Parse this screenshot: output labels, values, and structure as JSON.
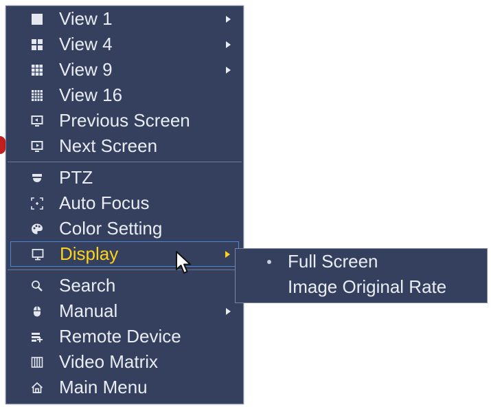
{
  "context_menu": {
    "items": [
      {
        "label": "View 1",
        "icon": "single-view-icon",
        "has_submenu": true
      },
      {
        "label": "View 4",
        "icon": "quad-view-icon",
        "has_submenu": true
      },
      {
        "label": "View 9",
        "icon": "nine-grid-icon",
        "has_submenu": true
      },
      {
        "label": "View 16",
        "icon": "sixteen-grid-icon",
        "has_submenu": false
      },
      {
        "label": "Previous Screen",
        "icon": "previous-screen-icon",
        "has_submenu": false
      },
      {
        "label": "Next Screen",
        "icon": "next-screen-icon",
        "has_submenu": false
      },
      {
        "label": "PTZ",
        "icon": "ptz-camera-icon",
        "has_submenu": false
      },
      {
        "label": "Auto Focus",
        "icon": "focus-icon",
        "has_submenu": false
      },
      {
        "label": "Color Setting",
        "icon": "palette-icon",
        "has_submenu": false
      },
      {
        "label": "Display",
        "icon": "monitor-icon",
        "has_submenu": true,
        "highlighted": true
      },
      {
        "label": "Search",
        "icon": "search-icon",
        "has_submenu": false
      },
      {
        "label": "Manual",
        "icon": "mouse-icon",
        "has_submenu": true
      },
      {
        "label": "Remote Device",
        "icon": "remote-device-icon",
        "has_submenu": false
      },
      {
        "label": "Video Matrix",
        "icon": "video-matrix-icon",
        "has_submenu": false
      },
      {
        "label": "Main Menu",
        "icon": "home-icon",
        "has_submenu": false
      }
    ]
  },
  "display_submenu": {
    "items": [
      {
        "label": "Full Screen",
        "selected": true
      },
      {
        "label": "Image Original Rate",
        "selected": false
      }
    ]
  },
  "colors": {
    "menu_background": "#34405e",
    "text": "#e9ecf3",
    "highlight_text": "#ffd21a",
    "highlight_border": "#4f86d8"
  }
}
